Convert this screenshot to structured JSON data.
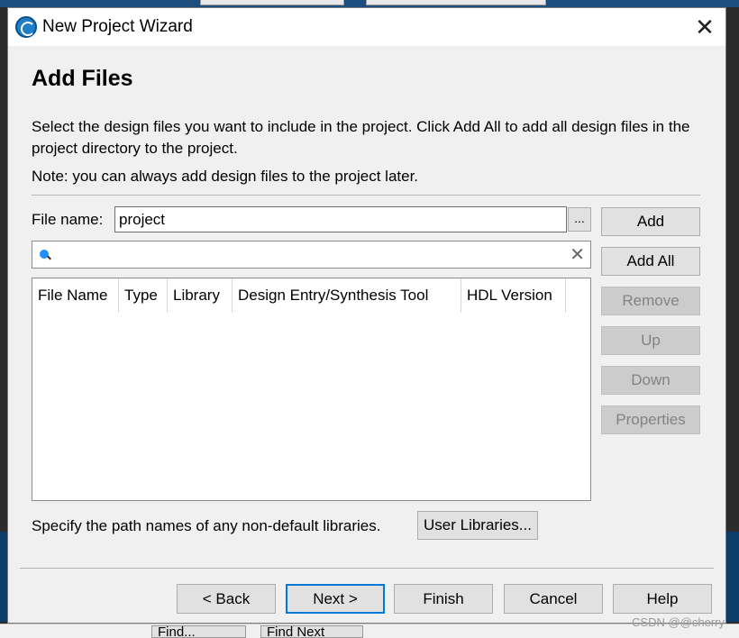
{
  "dialog": {
    "title": "New Project Wizard",
    "heading": "Add Files",
    "description": "Select the design files you want to include in the project. Click Add All to add all design files in the project directory to the project.",
    "note": "Note: you can always add design files to the project later."
  },
  "file_name": {
    "label": "File name:",
    "value": "project",
    "browse_label": "..."
  },
  "search": {
    "value": "",
    "clear_label": "✕"
  },
  "table": {
    "columns": [
      "File Name",
      "Type",
      "Library",
      "Design Entry/Synthesis Tool",
      "HDL Version"
    ],
    "rows": []
  },
  "side_buttons": {
    "add": "Add",
    "add_all": "Add All",
    "remove": "Remove",
    "up": "Up",
    "down": "Down",
    "properties": "Properties"
  },
  "libraries": {
    "text": "Specify the path names of any non-default libraries.",
    "button": "User Libraries..."
  },
  "bottom_buttons": {
    "back": "< Back",
    "next": "Next >",
    "finish": "Finish",
    "cancel": "Cancel",
    "help": "Help"
  },
  "background": {
    "find": "Find...",
    "find_next": "Find Next"
  },
  "watermark": "CSDN @@cherry",
  "colors": {
    "default_button_border": "#0078d7",
    "disabled_button_text": "#838383"
  }
}
